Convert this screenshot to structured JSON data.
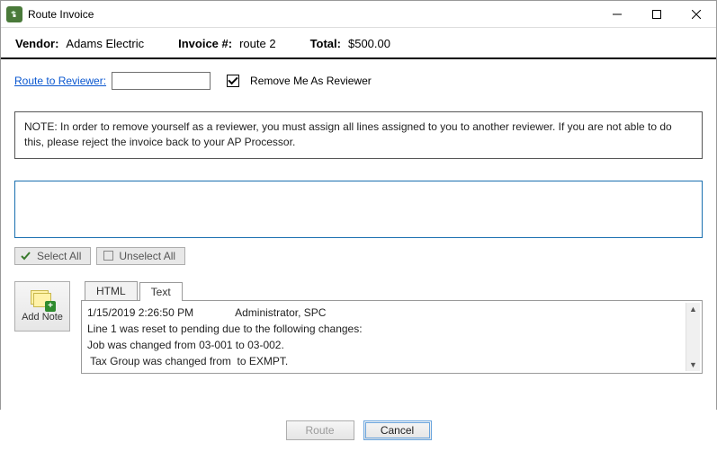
{
  "window": {
    "title": "Route Invoice"
  },
  "header": {
    "vendor_label": "Vendor:",
    "vendor": "Adams Electric",
    "invoice_num_label": "Invoice #:",
    "invoice_num": "route 2",
    "total_label": "Total:",
    "total": "$500.00"
  },
  "route": {
    "link_label": "Route to Reviewer:",
    "value": "",
    "remove_me_checked": true,
    "remove_me_label": "Remove Me As Reviewer"
  },
  "note_box": "NOTE: In order to remove yourself as a reviewer, you must assign all lines assigned to you to another reviewer. If you are not able to do this, please reject the invoice back to your AP Processor.",
  "selection": {
    "select_all": "Select All",
    "unselect_all": "Unselect All"
  },
  "add_note_label": "Add Note",
  "tabs": {
    "html": "HTML",
    "text": "Text",
    "active": "text"
  },
  "note_lines": [
    "1/15/2019 2:26:50 PM              Administrator, SPC",
    "Line 1 was reset to pending due to the following changes:",
    "Job was changed from 03-001 to 03-002.",
    " Tax Group was changed from  to EXMPT."
  ],
  "footer": {
    "route": "Route",
    "cancel": "Cancel"
  }
}
